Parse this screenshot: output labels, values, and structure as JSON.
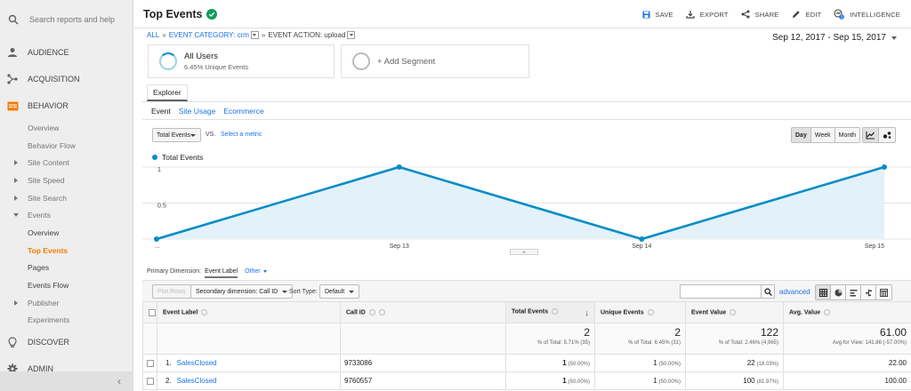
{
  "sidebar": {
    "search_placeholder": "Search reports and help",
    "sections": {
      "audience": "AUDIENCE",
      "acquisition": "ACQUISITION",
      "behavior": "BEHAVIOR",
      "discover": "DISCOVER",
      "admin": "ADMIN"
    },
    "behavior_items": {
      "overview": "Overview",
      "behavior_flow": "Behavior Flow",
      "site_content": "Site Content",
      "site_speed": "Site Speed",
      "site_search": "Site Search",
      "events": "Events",
      "events_overview": "Overview",
      "top_events": "Top Events",
      "pages": "Pages",
      "events_flow": "Events Flow",
      "publisher": "Publisher",
      "experiments": "Experiments"
    },
    "collapse_icon": "‹",
    "accent_color": "#f57c00"
  },
  "header": {
    "title": "Top Events",
    "actions": {
      "save": "SAVE",
      "export": "EXPORT",
      "share": "SHARE",
      "edit": "EDIT",
      "intelligence": "INTELLIGENCE"
    },
    "intelligence_badge": "3"
  },
  "breadcrumb": {
    "all": "ALL",
    "category": "EVENT CATEGORY: crm",
    "action": "EVENT ACTION: upload",
    "sep": "»"
  },
  "date_range": "Sep 12, 2017 - Sep 15, 2017",
  "segments": {
    "primary_name": "All Users",
    "primary_sub": "6.45% Unique Events",
    "add_label": "+ Add Segment"
  },
  "tabs": {
    "explorer": "Explorer",
    "sub": {
      "event": "Event",
      "site_usage": "Site Usage",
      "ecommerce": "Ecommerce"
    }
  },
  "chart_controls": {
    "metric": "Total Events",
    "vs": "VS.",
    "select_metric": "Select a metric",
    "periods": {
      "day": "Day",
      "week": "Week",
      "month": "Month"
    },
    "active_period": "Day"
  },
  "chart_data": {
    "type": "area",
    "title": "",
    "series": [
      {
        "name": "Total Events",
        "color": "#058dc7",
        "values": [
          0,
          1,
          0,
          1
        ]
      }
    ],
    "x": [
      "...",
      "Sep 13",
      "Sep 14",
      "Sep 15"
    ],
    "y_ticks": [
      "1",
      "0.5"
    ],
    "ylim": [
      0,
      1
    ],
    "grid": true,
    "legend": "top-left"
  },
  "primary_dimension": {
    "label": "Primary Dimension:",
    "current": "Event Label",
    "other": "Other"
  },
  "table_toolbar": {
    "plot_rows": "Plot Rows",
    "secondary_dimension": "Secondary dimension: Call ID",
    "sort_type_label": "Sort Type:",
    "sort_type_value": "Default",
    "advanced": "advanced"
  },
  "table": {
    "headers": {
      "event_label": "Event Label",
      "call_id": "Call ID",
      "total_events": "Total Events",
      "unique_events": "Unique Events",
      "event_value": "Event Value",
      "avg_value": "Avg. Value"
    },
    "sort_icon": "↓",
    "totals": {
      "total_events": "2",
      "total_events_sub": "% of Total: 5.71% (35)",
      "unique_events": "2",
      "unique_events_sub": "% of Total: 6.45% (31)",
      "event_value": "122",
      "event_value_sub": "% of Total: 2.46% (4,965)",
      "avg_value": "61.00",
      "avg_value_sub": "Avg for View: 141.86 (-57.00%)"
    },
    "rows": [
      {
        "index": "1.",
        "label": "SalesClosed",
        "call_id": "9733086",
        "total_events": "1",
        "total_events_pct": "(50.00%)",
        "unique_events": "1",
        "unique_events_pct": "(50.00%)",
        "event_value": "22",
        "event_value_pct": "(18.03%)",
        "avg_value": "22.00"
      },
      {
        "index": "2.",
        "label": "SalesClosed",
        "call_id": "9760557",
        "total_events": "1",
        "total_events_pct": "(50.00%)",
        "unique_events": "1",
        "unique_events_pct": "(50.00%)",
        "event_value": "100",
        "event_value_pct": "(81.97%)",
        "avg_value": "100.00"
      }
    ]
  }
}
